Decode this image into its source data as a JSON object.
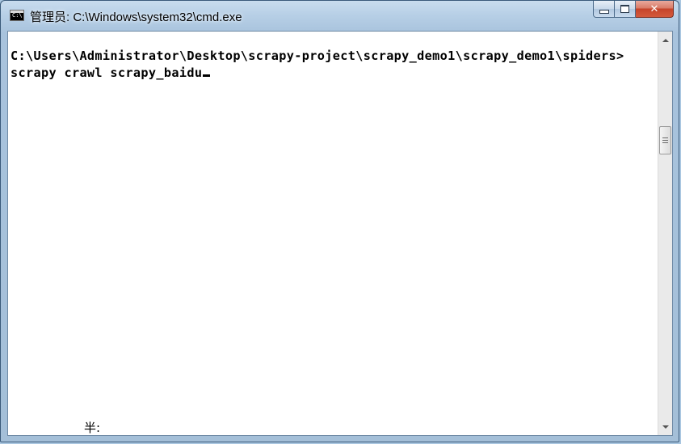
{
  "window": {
    "title": "管理员: C:\\Windows\\system32\\cmd.exe",
    "icon": "cmd-icon",
    "icon_label": "C:\\"
  },
  "caption_buttons": {
    "minimize_icon": "minimize-icon",
    "maximize_icon": "maximize-icon",
    "close_icon": "close-icon",
    "close_glyph": "✕"
  },
  "console": {
    "lines": [
      "C:\\Users\\Administrator\\Desktop\\scrapy-project\\scrapy_demo1\\scrapy_demo1\\spiders>",
      "scrapy crawl scrapy_baidu"
    ],
    "ime_status": "半:"
  },
  "scrollbar": {
    "up_icon": "scroll-up-arrow-icon",
    "down_icon": "scroll-down-arrow-icon"
  }
}
